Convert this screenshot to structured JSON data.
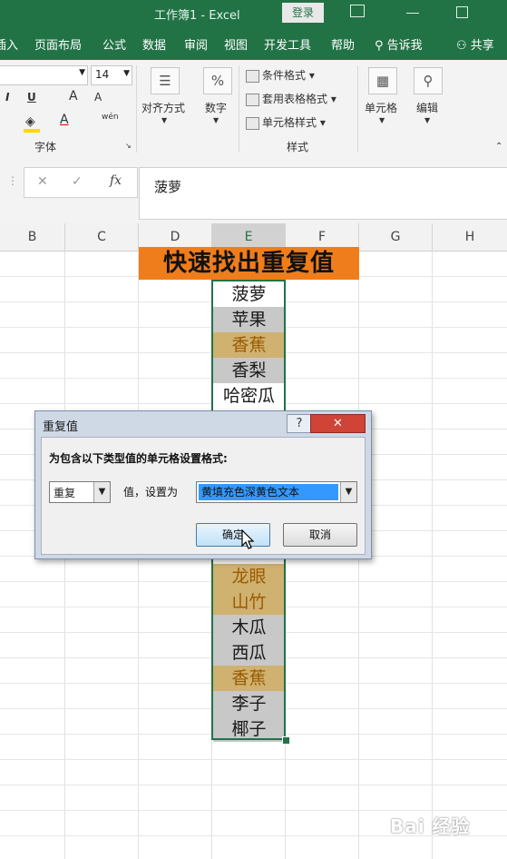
{
  "window": {
    "title": "工作簿1  -  Excel",
    "login_label": "登录"
  },
  "menu": {
    "items": [
      "插入",
      "页面布局",
      "公式",
      "数据",
      "审阅",
      "视图",
      "开发工具",
      "帮助"
    ],
    "tell_me": "告诉我",
    "share": "共享"
  },
  "ribbon": {
    "font_size": "14",
    "bold_italic": "I",
    "underline": "U",
    "grow_font": "A",
    "shrink_font": "A",
    "font_color_sample": "A",
    "phonetic": "wén",
    "font_group": "字体",
    "alignment": "对齐方式",
    "number": "数字",
    "number_symbol": "%",
    "conditional_format": "条件格式",
    "table_format": "套用表格格式",
    "cell_styles": "单元格样式",
    "styles_group": "样式",
    "cells": "单元格",
    "editing": "编辑"
  },
  "formula_bar": {
    "cancel": "✕",
    "enter": "✓",
    "fx": "fx",
    "content": "菠萝"
  },
  "grid": {
    "columns": [
      "B",
      "C",
      "D",
      "E",
      "F",
      "G",
      "H"
    ],
    "banner": "快速找出重复值",
    "cells": [
      {
        "text": "菠萝",
        "bg": "#ffffff",
        "color": "#1a1a1a"
      },
      {
        "text": "苹果",
        "bg": "#c8c8c8",
        "color": "#1a1a1a"
      },
      {
        "text": "香蕉",
        "bg": "#cfb170",
        "color": "#9a5a00"
      },
      {
        "text": "香梨",
        "bg": "#c8c8c8",
        "color": "#1a1a1a"
      },
      {
        "text": "哈密瓜",
        "bg": "#ffffff",
        "color": "#1a1a1a"
      },
      {
        "text": "龙眼",
        "bg": "#cfb170",
        "color": "#9a5a00"
      },
      {
        "text": "山竹",
        "bg": "#cfb170",
        "color": "#9a5a00"
      },
      {
        "text": "木瓜",
        "bg": "#c8c8c8",
        "color": "#1a1a1a"
      },
      {
        "text": "西瓜",
        "bg": "#c8c8c8",
        "color": "#1a1a1a"
      },
      {
        "text": "香蕉",
        "bg": "#cfb170",
        "color": "#9a5a00"
      },
      {
        "text": "李子",
        "bg": "#c8c8c8",
        "color": "#1a1a1a"
      },
      {
        "text": "椰子",
        "bg": "#c8c8c8",
        "color": "#1a1a1a"
      }
    ]
  },
  "dialog": {
    "title": "重复值",
    "help": "?",
    "close": "✕",
    "prompt": "为包含以下类型值的单元格设置格式:",
    "type_value": "重复",
    "value_label": "值，设置为",
    "format_value": "黄填充色深黄色文本",
    "ok": "确定",
    "cancel": "取消"
  },
  "watermark": "Bai 经验"
}
